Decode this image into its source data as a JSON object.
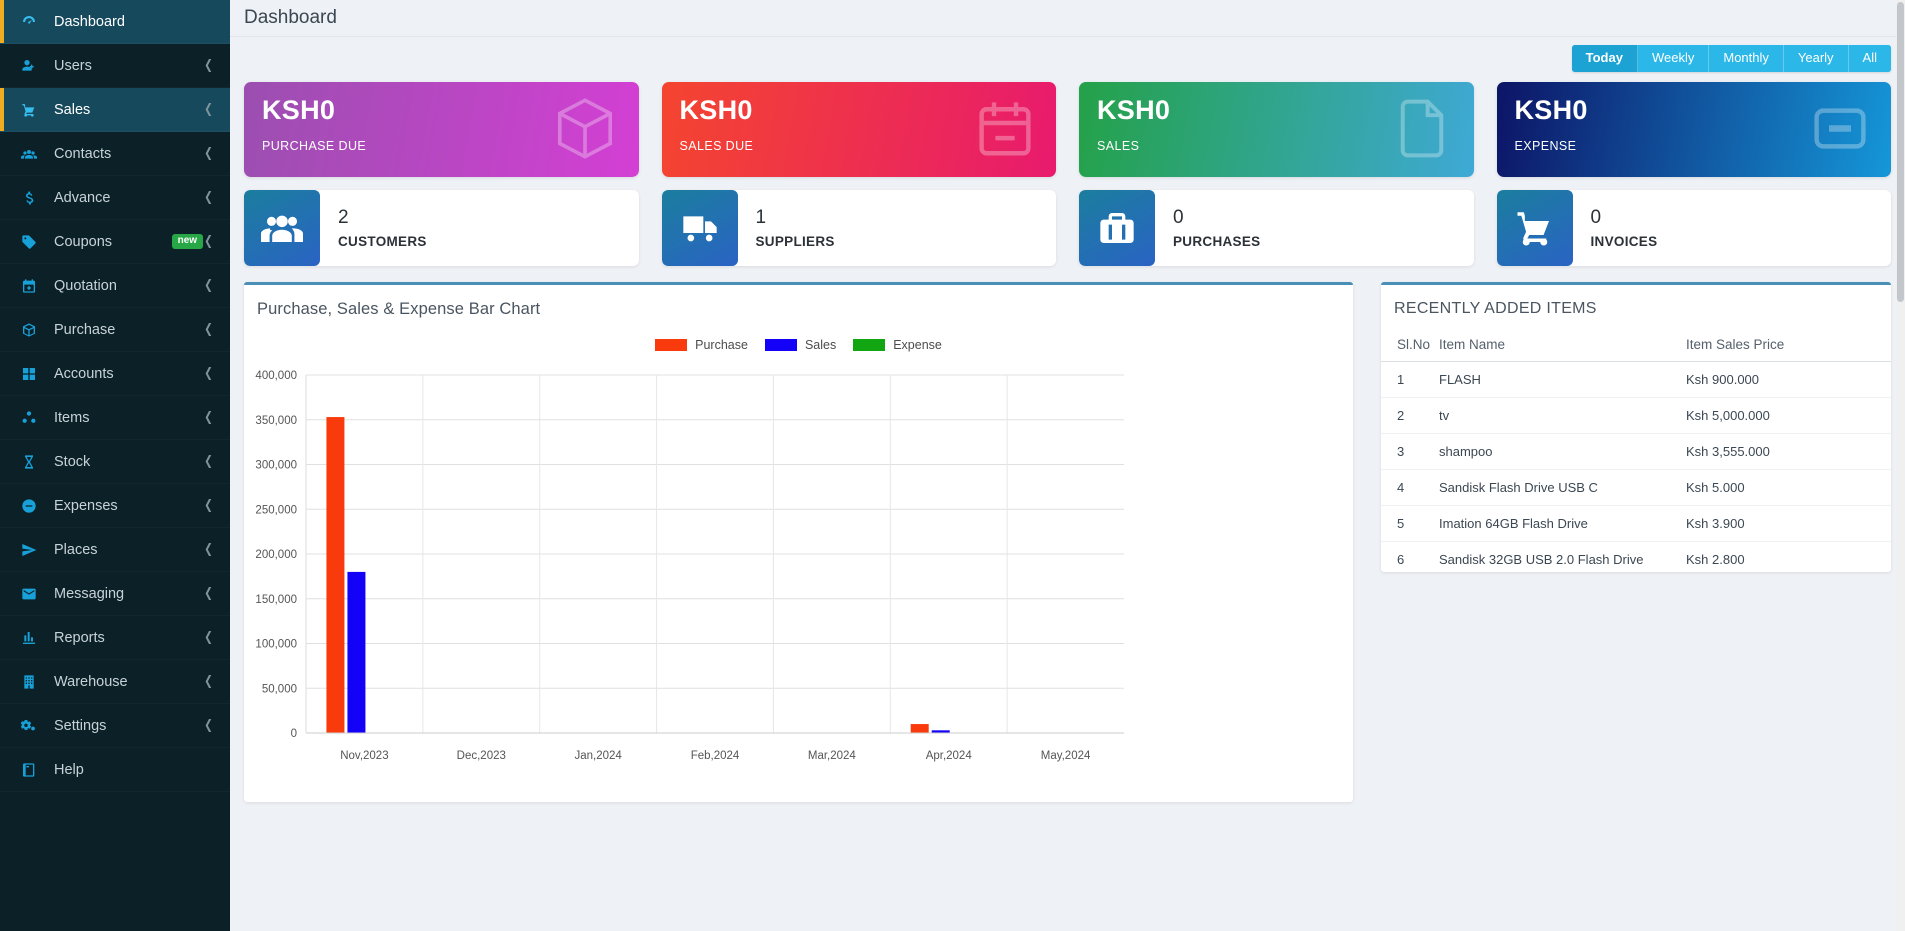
{
  "sidebar": {
    "items": [
      {
        "label": "Dashboard",
        "icon": "dashboard-icon",
        "active": true,
        "caret": false,
        "badge": null
      },
      {
        "label": "Users",
        "icon": "users-icon",
        "active": false,
        "caret": true,
        "badge": null
      },
      {
        "label": "Sales",
        "icon": "cart-icon",
        "active": true,
        "caret": true,
        "badge": null
      },
      {
        "label": "Contacts",
        "icon": "contacts-icon",
        "active": false,
        "caret": true,
        "badge": null
      },
      {
        "label": "Advance",
        "icon": "dollar-icon",
        "active": false,
        "caret": true,
        "badge": null
      },
      {
        "label": "Coupons",
        "icon": "tag-icon",
        "active": false,
        "caret": true,
        "badge": "new"
      },
      {
        "label": "Quotation",
        "icon": "calendar-icon",
        "active": false,
        "caret": true,
        "badge": null
      },
      {
        "label": "Purchase",
        "icon": "box-icon",
        "active": false,
        "caret": true,
        "badge": null
      },
      {
        "label": "Accounts",
        "icon": "grid-icon",
        "active": false,
        "caret": true,
        "badge": null
      },
      {
        "label": "Items",
        "icon": "items-icon",
        "active": false,
        "caret": true,
        "badge": null
      },
      {
        "label": "Stock",
        "icon": "hourglass-icon",
        "active": false,
        "caret": true,
        "badge": null
      },
      {
        "label": "Expenses",
        "icon": "minus-circle-icon",
        "active": false,
        "caret": true,
        "badge": null
      },
      {
        "label": "Places",
        "icon": "paper-plane-icon",
        "active": false,
        "caret": true,
        "badge": null
      },
      {
        "label": "Messaging",
        "icon": "envelope-icon",
        "active": false,
        "caret": true,
        "badge": null
      },
      {
        "label": "Reports",
        "icon": "bar-chart-icon",
        "active": false,
        "caret": true,
        "badge": null
      },
      {
        "label": "Warehouse",
        "icon": "building-icon",
        "active": false,
        "caret": true,
        "badge": null
      },
      {
        "label": "Settings",
        "icon": "gears-icon",
        "active": false,
        "caret": true,
        "badge": null
      },
      {
        "label": "Help",
        "icon": "book-icon",
        "active": false,
        "caret": false,
        "badge": null
      }
    ]
  },
  "header": {
    "title": "Dashboard"
  },
  "filters": {
    "options": [
      "Today",
      "Weekly",
      "Monthly",
      "Yearly",
      "All"
    ],
    "active": "Today"
  },
  "summary_cards": [
    {
      "amount": "KSH0",
      "caption": "PURCHASE DUE",
      "icon": "box-icon",
      "theme": "c-purple"
    },
    {
      "amount": "KSH0",
      "caption": "SALES DUE",
      "icon": "calendar-icon",
      "theme": "c-red"
    },
    {
      "amount": "KSH0",
      "caption": "SALES",
      "icon": "file-icon",
      "theme": "c-green"
    },
    {
      "amount": "KSH0",
      "caption": "EXPENSE",
      "icon": "minus-box-icon",
      "theme": "c-navy"
    }
  ],
  "count_cards": [
    {
      "count": "2",
      "caption": "CUSTOMERS",
      "icon": "people-icon"
    },
    {
      "count": "1",
      "caption": "SUPPLIERS",
      "icon": "truck-icon"
    },
    {
      "count": "0",
      "caption": "PURCHASES",
      "icon": "briefcase-icon"
    },
    {
      "count": "0",
      "caption": "INVOICES",
      "icon": "cart-icon"
    }
  ],
  "chart_panel": {
    "title": "Purchase, Sales & Expense Bar Chart"
  },
  "items_panel": {
    "title": "RECENTLY ADDED ITEMS",
    "columns": [
      "Sl.No",
      "Item Name",
      "Item Sales Price"
    ],
    "rows": [
      {
        "sl": "1",
        "name": "FLASH",
        "price": "Ksh 900.000"
      },
      {
        "sl": "2",
        "name": "tv",
        "price": "Ksh 5,000.000"
      },
      {
        "sl": "3",
        "name": "shampoo",
        "price": "Ksh 3,555.000"
      },
      {
        "sl": "4",
        "name": "Sandisk Flash Drive USB C",
        "price": "Ksh 5.000"
      },
      {
        "sl": "5",
        "name": "Imation 64GB Flash Drive",
        "price": "Ksh 3.900"
      },
      {
        "sl": "6",
        "name": "Sandisk 32GB USB 2.0 Flash Drive",
        "price": "Ksh 2.800"
      }
    ]
  },
  "chart_data": {
    "type": "bar",
    "title": "Purchase, Sales & Expense Bar Chart",
    "xlabel": "",
    "ylabel": "",
    "categories": [
      "Nov,2023",
      "Dec,2023",
      "Jan,2024",
      "Feb,2024",
      "Mar,2024",
      "Apr,2024",
      "May,2024"
    ],
    "series": [
      {
        "name": "Purchase",
        "color": "#f93a0c",
        "values": [
          353000,
          0,
          0,
          0,
          0,
          10000,
          0
        ]
      },
      {
        "name": "Sales",
        "color": "#1302f7",
        "values": [
          180000,
          0,
          0,
          0,
          0,
          3000,
          0
        ]
      },
      {
        "name": "Expense",
        "color": "#12a612",
        "values": [
          0,
          0,
          0,
          0,
          0,
          0,
          0
        ]
      }
    ],
    "ylim": [
      0,
      400000
    ],
    "yticks": [
      0,
      50000,
      100000,
      150000,
      200000,
      250000,
      300000,
      350000,
      400000
    ],
    "ytick_labels": [
      "0",
      "50,000",
      "100,000",
      "150,000",
      "200,000",
      "250,000",
      "300,000",
      "350,000",
      "400,000"
    ],
    "grid": true,
    "legend_position": "top-center"
  },
  "colors": {
    "sidebar_bg": "#0b2027",
    "sidebar_active": "#17495c",
    "accent_yellow": "#f0ad22",
    "icon_blue": "#18a0d8",
    "filter_blue": "#2bb8e8",
    "filter_active": "#1da2d4",
    "panel_top_border": "#4a8fb5",
    "purchase": "#f93a0c",
    "sales": "#1302f7",
    "expense": "#12a612"
  }
}
